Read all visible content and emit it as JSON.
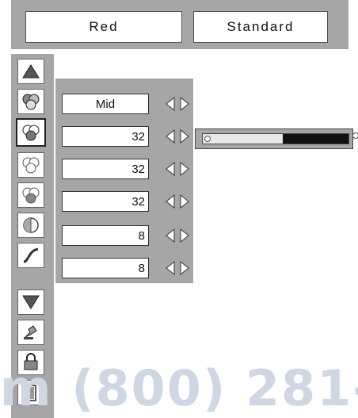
{
  "header": {
    "color_label": "Red",
    "mode_label": "Standard"
  },
  "menu_icons": [
    {
      "name": "scroll-up-icon"
    },
    {
      "name": "color-balance-icon"
    },
    {
      "name": "color-selected-icon"
    },
    {
      "name": "color-adjust-icon"
    },
    {
      "name": "color-adjust-icon-2"
    },
    {
      "name": "contrast-icon"
    },
    {
      "name": "gamma-curve-icon"
    },
    {
      "name": "scroll-down-icon"
    },
    {
      "name": "reset-icon"
    },
    {
      "name": "store-icon"
    },
    {
      "name": "exit-icon"
    }
  ],
  "values": {
    "level": "Mid",
    "r1": "32",
    "r2": "32",
    "r3": "32",
    "r4": "8",
    "r5": "8"
  },
  "slider": {
    "value_fraction": 0.55
  },
  "watermark": "m (800) 281-",
  "colors": {
    "panel": "#a6a6a6",
    "slider_track": "#111111",
    "slider_fill": "#e8e8e8"
  }
}
